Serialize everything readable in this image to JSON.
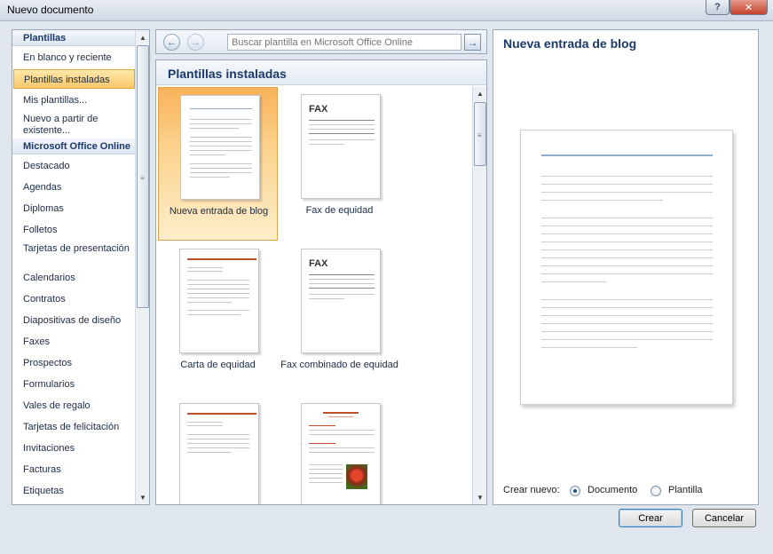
{
  "window": {
    "title": "Nuevo documento",
    "help_label": "?",
    "close_label": "✕"
  },
  "nav": {
    "sections": [
      {
        "header": "Plantillas",
        "items": [
          "En blanco y reciente",
          "Plantillas instaladas",
          "Mis plantillas...",
          "Nuevo a partir de existente..."
        ]
      },
      {
        "header": "Microsoft Office Online",
        "items": [
          "Destacado",
          "Agendas",
          "Diplomas",
          "Folletos",
          "Tarjetas de presentación",
          "Calendarios",
          "Contratos",
          "Diapositivas de diseño",
          "Faxes",
          "Prospectos",
          "Formularios",
          "Vales de regalo",
          "Tarjetas de felicitación",
          "Invitaciones",
          "Facturas",
          "Etiquetas"
        ]
      }
    ],
    "selected_item": "Plantillas instaladas"
  },
  "toolbar": {
    "back_icon": "arrow-left-icon",
    "forward_icon": "arrow-right-icon",
    "search_placeholder": "Buscar plantilla en Microsoft Office Online",
    "search_go_icon": "arrow-right-icon"
  },
  "gallery": {
    "title": "Plantillas instaladas",
    "templates": [
      {
        "label": "Nueva entrada de blog",
        "selected": true
      },
      {
        "label": "Fax de equidad"
      },
      {
        "label": "Carta de equidad"
      },
      {
        "label": "Fax combinado de equidad"
      },
      {
        "label": ""
      },
      {
        "label": ""
      }
    ],
    "fax_text": "FAX"
  },
  "preview": {
    "title": "Nueva entrada de blog",
    "create_new_label": "Crear nuevo:",
    "options": [
      {
        "label": "Documento",
        "checked": true
      },
      {
        "label": "Plantilla",
        "checked": false
      }
    ]
  },
  "buttons": {
    "create": "Crear",
    "cancel": "Cancelar"
  },
  "colors": {
    "selection": "#f8c767",
    "header_text": "#1b3969",
    "accent_red": "#c0502c"
  }
}
